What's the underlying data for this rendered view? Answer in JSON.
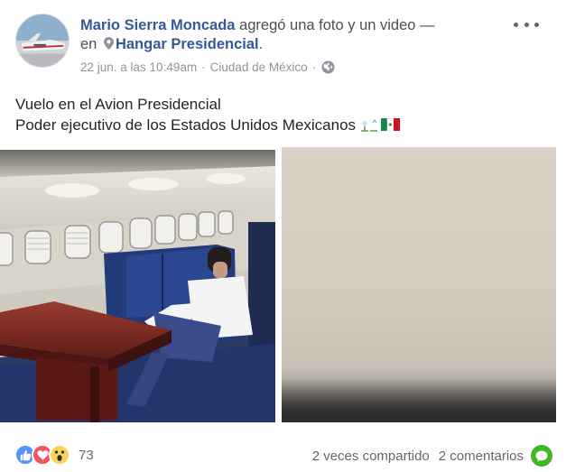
{
  "post": {
    "author": "Mario Sierra Moncada",
    "action_text": " agregó una foto y un video —",
    "in_text": "en",
    "location_name": "Hangar Presidencial",
    "location_suffix": ".",
    "date": "22 jun. a las 10:49am",
    "city": "Ciudad de México",
    "separator": "·",
    "text_line1": "Vuelo en el Avion Presidencial",
    "text_line2": "Poder ejecutivo de los Estados Unidos Mexicanos"
  },
  "footer": {
    "reaction_count": "73",
    "shares": "2 veces compartido",
    "comments": "2 comentarios"
  },
  "icons": {
    "more": "more-options-icon",
    "pin": "location-pin-icon",
    "globe": "globe-icon",
    "like": "like-reaction-icon",
    "love": "love-reaction-icon",
    "wow": "wow-reaction-icon",
    "chat": "comment-bubble-icon",
    "flag": "mexico-flag-icon"
  },
  "colors": {
    "link": "#365899",
    "meta": "#90949c",
    "like": "#5890ff",
    "love": "#f25268",
    "wow": "#fbd455",
    "chat": "#42b72a"
  }
}
